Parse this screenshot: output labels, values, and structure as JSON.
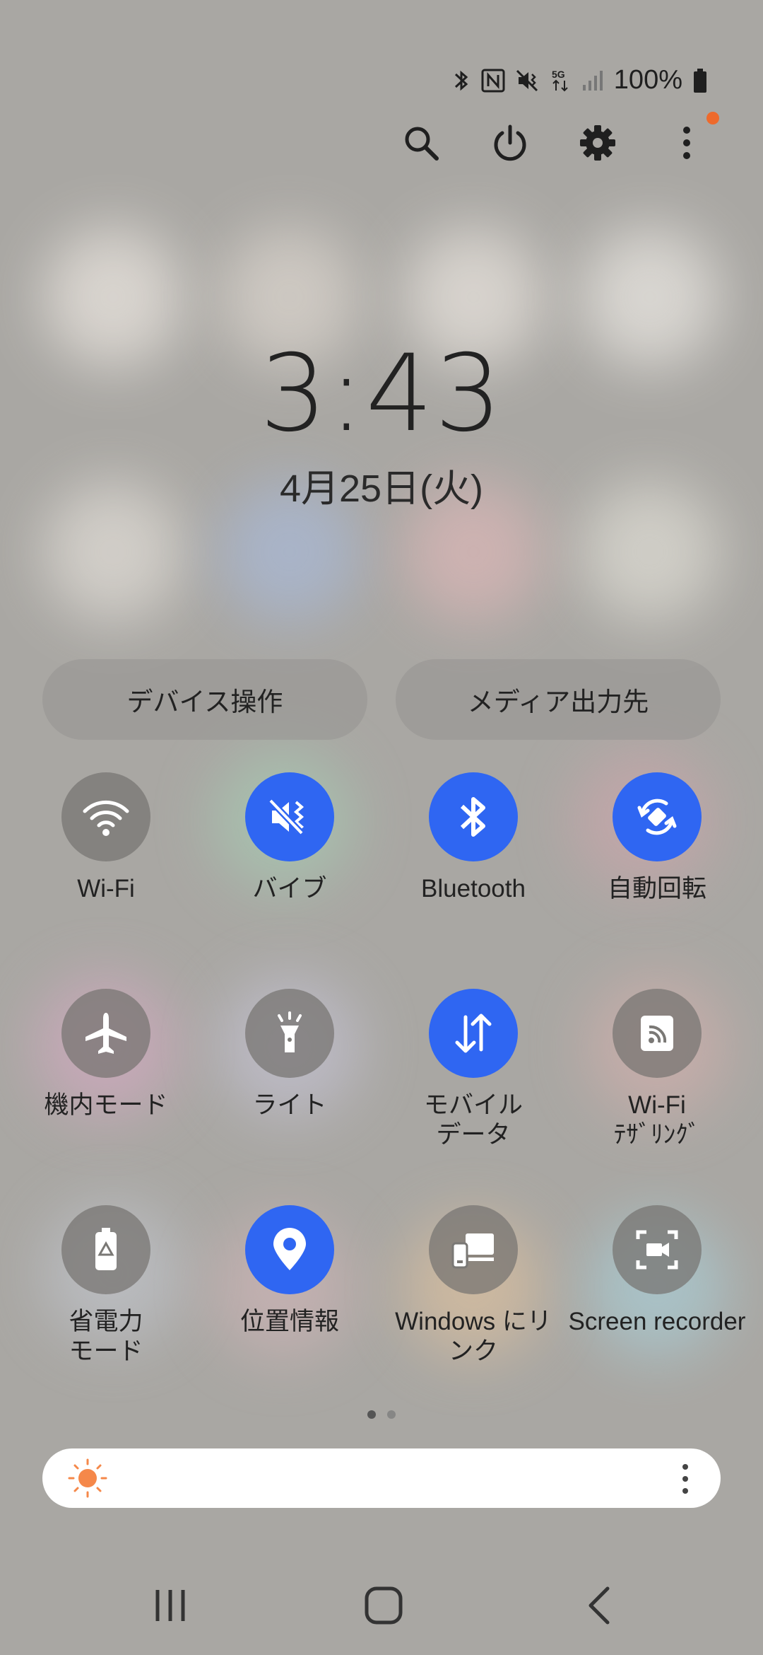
{
  "status_bar": {
    "battery_text": "100%",
    "icons": [
      "bluetooth-icon",
      "nfc-icon",
      "vibrate-icon",
      "5g-icon",
      "signal-icon",
      "battery-icon"
    ]
  },
  "top_actions": {
    "icons": [
      "search-icon",
      "power-icon",
      "settings-icon",
      "more-icon"
    ],
    "notification_dot_color": "#ee6a2c"
  },
  "clock": {
    "time": "3:43",
    "date": "4月25日(火)"
  },
  "buttons": {
    "device_control": "デバイス操作",
    "media_output": "メディア出力先"
  },
  "tiles": [
    {
      "label": "Wi-Fi",
      "state": "off",
      "icon": "wifi-icon"
    },
    {
      "label": "バイブ",
      "state": "on",
      "icon": "vibrate-icon"
    },
    {
      "label": "Bluetooth",
      "state": "on",
      "icon": "bluetooth-icon"
    },
    {
      "label": "自動回転",
      "state": "on",
      "icon": "auto-rotate-icon"
    },
    {
      "label": "機内モード",
      "state": "off",
      "icon": "airplane-icon"
    },
    {
      "label": "ライト",
      "state": "off",
      "icon": "flashlight-icon"
    },
    {
      "label": "モバイル\nデータ",
      "state": "on",
      "icon": "mobile-data-icon"
    },
    {
      "label": "Wi-Fi\nﾃｻﾞﾘﾝｸﾞ",
      "state": "off",
      "icon": "hotspot-icon"
    },
    {
      "label": "省電力\nモード",
      "state": "off",
      "icon": "battery-saver-icon"
    },
    {
      "label": "位置情報",
      "state": "on",
      "icon": "location-icon"
    },
    {
      "label": "Windows にリ\nンク",
      "state": "off",
      "icon": "link-to-windows-icon"
    },
    {
      "label": "Screen recorder",
      "state": "off",
      "icon": "screen-recorder-icon"
    }
  ],
  "pagination": {
    "current_page": 1,
    "total_pages": 2
  },
  "brightness": {
    "icon": "sun-icon",
    "sun_color": "#f5884a",
    "level": 0.0
  },
  "nav_bar": {
    "icons": [
      "recents-icon",
      "home-icon",
      "back-icon"
    ]
  },
  "colors": {
    "tile_on": "#2f66f2",
    "tile_off": "#7a7875"
  }
}
